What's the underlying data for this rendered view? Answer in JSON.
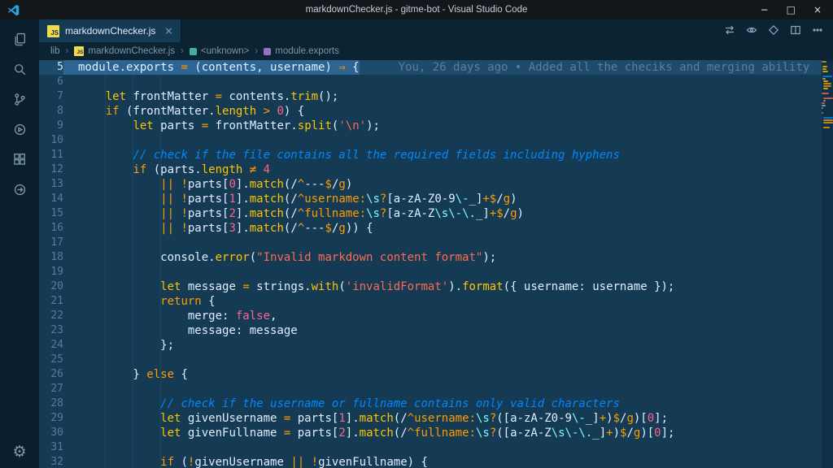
{
  "window": {
    "title": "markdownChecker.js - gitme-bot - Visual Studio Code",
    "controls": {
      "minimize": "−",
      "maximize": "□",
      "close": "×"
    }
  },
  "activity_bar": {
    "items": [
      "explorer",
      "search",
      "source-control",
      "run-debug",
      "extensions",
      "remote"
    ],
    "settings_label": "manage",
    "settings_glyph": "⚙"
  },
  "tab_bar": {
    "js_badge": "JS",
    "tabs": [
      {
        "label": "markdownChecker.js",
        "close": "×",
        "active": true
      }
    ],
    "actions": [
      "open-changes",
      "toggle-blame",
      "compare",
      "split-editor",
      "more-actions"
    ]
  },
  "breadcrumbs": {
    "separator": "›",
    "items": [
      {
        "label": "lib",
        "icon": null
      },
      {
        "label": "markdownChecker.js",
        "icon": "js-file"
      },
      {
        "label": "<unknown>",
        "icon": "symbol-unknown"
      },
      {
        "label": "module.exports",
        "icon": "symbol-module"
      }
    ]
  },
  "editor": {
    "current_line": 5,
    "blame": "You, 26 days ago • Added all the checiks and merging ability",
    "lines": [
      {
        "n": 5,
        "t": [
          [
            "w",
            "module.exports "
          ],
          [
            "o",
            "="
          ],
          [
            "w",
            " (contents, username) "
          ],
          [
            "o",
            "⇒"
          ],
          [
            "w",
            " {"
          ]
        ]
      },
      {
        "n": 6,
        "t": []
      },
      {
        "n": 7,
        "t": [
          [
            "w",
            "    "
          ],
          [
            "y",
            "let"
          ],
          [
            "w",
            " frontMatter "
          ],
          [
            "o",
            "="
          ],
          [
            "w",
            " contents."
          ],
          [
            "y",
            "trim"
          ],
          [
            "w",
            "();"
          ]
        ]
      },
      {
        "n": 8,
        "t": [
          [
            "w",
            "    "
          ],
          [
            "o",
            "if"
          ],
          [
            "w",
            " (frontMatter."
          ],
          [
            "y",
            "length"
          ],
          [
            "w",
            " "
          ],
          [
            "o",
            ">"
          ],
          [
            "w",
            " "
          ],
          [
            "n",
            "0"
          ],
          [
            "w",
            ") {"
          ]
        ]
      },
      {
        "n": 9,
        "t": [
          [
            "w",
            "        "
          ],
          [
            "y",
            "let"
          ],
          [
            "w",
            " parts "
          ],
          [
            "o",
            "="
          ],
          [
            "w",
            " frontMatter."
          ],
          [
            "y",
            "split"
          ],
          [
            "w",
            "("
          ],
          [
            "r",
            "'\\n'"
          ],
          [
            "w",
            ");"
          ]
        ]
      },
      {
        "n": 10,
        "t": []
      },
      {
        "n": 11,
        "t": [
          [
            "w",
            "        "
          ],
          [
            "b",
            "// check if the file contains all the required fields including hyphens"
          ]
        ]
      },
      {
        "n": 12,
        "t": [
          [
            "w",
            "        "
          ],
          [
            "o",
            "if"
          ],
          [
            "w",
            " (parts."
          ],
          [
            "y",
            "length"
          ],
          [
            "w",
            " "
          ],
          [
            "o",
            "≠"
          ],
          [
            "w",
            " "
          ],
          [
            "n",
            "4"
          ]
        ]
      },
      {
        "n": 13,
        "t": [
          [
            "w",
            "            "
          ],
          [
            "o",
            "|| !"
          ],
          [
            "w",
            "parts["
          ],
          [
            "n",
            "0"
          ],
          [
            "w",
            "]."
          ],
          [
            "y",
            "match"
          ],
          [
            "w",
            "(/"
          ],
          [
            "o",
            "^"
          ],
          [
            "w",
            "---"
          ],
          [
            "o",
            "$"
          ],
          [
            "w",
            "/"
          ],
          [
            "o",
            "g"
          ],
          [
            "w",
            ")"
          ]
        ]
      },
      {
        "n": 14,
        "t": [
          [
            "w",
            "            "
          ],
          [
            "o",
            "|| !"
          ],
          [
            "w",
            "parts["
          ],
          [
            "n",
            "1"
          ],
          [
            "w",
            "]."
          ],
          [
            "y",
            "match"
          ],
          [
            "w",
            "(/"
          ],
          [
            "o",
            "^username:"
          ],
          [
            "c",
            "\\s"
          ],
          [
            "o",
            "?"
          ],
          [
            "w",
            "[a-zA-Z0-9"
          ],
          [
            "c",
            "\\-"
          ],
          [
            "w",
            "_]"
          ],
          [
            "o",
            "+$"
          ],
          [
            "w",
            "/"
          ],
          [
            "o",
            "g"
          ],
          [
            "w",
            ")"
          ]
        ]
      },
      {
        "n": 15,
        "t": [
          [
            "w",
            "            "
          ],
          [
            "o",
            "|| !"
          ],
          [
            "w",
            "parts["
          ],
          [
            "n",
            "2"
          ],
          [
            "w",
            "]."
          ],
          [
            "y",
            "match"
          ],
          [
            "w",
            "(/"
          ],
          [
            "o",
            "^fullname:"
          ],
          [
            "c",
            "\\s"
          ],
          [
            "o",
            "?"
          ],
          [
            "w",
            "[a-zA-Z"
          ],
          [
            "c",
            "\\s\\-\\."
          ],
          [
            "w",
            "_]"
          ],
          [
            "o",
            "+$"
          ],
          [
            "w",
            "/"
          ],
          [
            "o",
            "g"
          ],
          [
            "w",
            ")"
          ]
        ]
      },
      {
        "n": 16,
        "t": [
          [
            "w",
            "            "
          ],
          [
            "o",
            "|| !"
          ],
          [
            "w",
            "parts["
          ],
          [
            "n",
            "3"
          ],
          [
            "w",
            "]."
          ],
          [
            "y",
            "match"
          ],
          [
            "w",
            "(/"
          ],
          [
            "o",
            "^"
          ],
          [
            "w",
            "---"
          ],
          [
            "o",
            "$"
          ],
          [
            "w",
            "/"
          ],
          [
            "o",
            "g"
          ],
          [
            "w",
            ")) {"
          ]
        ]
      },
      {
        "n": 17,
        "t": []
      },
      {
        "n": 18,
        "t": [
          [
            "w",
            "            console."
          ],
          [
            "y",
            "error"
          ],
          [
            "w",
            "("
          ],
          [
            "r",
            "\"Invalid markdown content format\""
          ],
          [
            "w",
            ");"
          ]
        ]
      },
      {
        "n": 19,
        "t": []
      },
      {
        "n": 20,
        "t": [
          [
            "w",
            "            "
          ],
          [
            "y",
            "let"
          ],
          [
            "w",
            " message "
          ],
          [
            "o",
            "="
          ],
          [
            "w",
            " strings."
          ],
          [
            "y",
            "with"
          ],
          [
            "w",
            "("
          ],
          [
            "r",
            "'invalidFormat'"
          ],
          [
            "w",
            ")."
          ],
          [
            "y",
            "format"
          ],
          [
            "w",
            "({ username: username });"
          ]
        ]
      },
      {
        "n": 21,
        "t": [
          [
            "w",
            "            "
          ],
          [
            "o",
            "return"
          ],
          [
            "w",
            " {"
          ]
        ]
      },
      {
        "n": 22,
        "t": [
          [
            "w",
            "                merge: "
          ],
          [
            "n",
            "false"
          ],
          [
            "w",
            ","
          ]
        ]
      },
      {
        "n": 23,
        "t": [
          [
            "w",
            "                message: message"
          ]
        ]
      },
      {
        "n": 24,
        "t": [
          [
            "w",
            "            };"
          ]
        ]
      },
      {
        "n": 25,
        "t": []
      },
      {
        "n": 26,
        "t": [
          [
            "w",
            "        } "
          ],
          [
            "o",
            "else"
          ],
          [
            "w",
            " {"
          ]
        ]
      },
      {
        "n": 27,
        "t": []
      },
      {
        "n": 28,
        "t": [
          [
            "w",
            "            "
          ],
          [
            "b",
            "// check if the username or fullname contains only valid characters"
          ]
        ]
      },
      {
        "n": 29,
        "t": [
          [
            "w",
            "            "
          ],
          [
            "y",
            "let"
          ],
          [
            "w",
            " givenUsername "
          ],
          [
            "o",
            "="
          ],
          [
            "w",
            " parts["
          ],
          [
            "n",
            "1"
          ],
          [
            "w",
            "]."
          ],
          [
            "y",
            "match"
          ],
          [
            "w",
            "(/"
          ],
          [
            "o",
            "^username:"
          ],
          [
            "c",
            "\\s"
          ],
          [
            "o",
            "?"
          ],
          [
            "w",
            "(["
          ],
          [
            "w",
            "a-zA-Z0-9"
          ],
          [
            "c",
            "\\-"
          ],
          [
            "w",
            "_]"
          ],
          [
            "o",
            "+"
          ],
          [
            "w",
            ")"
          ],
          [
            "o",
            "$"
          ],
          [
            "w",
            "/"
          ],
          [
            "o",
            "g"
          ],
          [
            "w",
            ")["
          ],
          [
            "n",
            "0"
          ],
          [
            "w",
            "];"
          ]
        ]
      },
      {
        "n": 30,
        "t": [
          [
            "w",
            "            "
          ],
          [
            "y",
            "let"
          ],
          [
            "w",
            " givenFullname "
          ],
          [
            "o",
            "="
          ],
          [
            "w",
            " parts["
          ],
          [
            "n",
            "2"
          ],
          [
            "w",
            "]."
          ],
          [
            "y",
            "match"
          ],
          [
            "w",
            "(/"
          ],
          [
            "o",
            "^fullname:"
          ],
          [
            "c",
            "\\s"
          ],
          [
            "o",
            "?"
          ],
          [
            "w",
            "(["
          ],
          [
            "w",
            "a-zA-Z"
          ],
          [
            "c",
            "\\s\\-\\."
          ],
          [
            "w",
            "_]"
          ],
          [
            "o",
            "+"
          ],
          [
            "w",
            ")"
          ],
          [
            "o",
            "$"
          ],
          [
            "w",
            "/"
          ],
          [
            "o",
            "g"
          ],
          [
            "w",
            ")["
          ],
          [
            "n",
            "0"
          ],
          [
            "w",
            "];"
          ]
        ]
      },
      {
        "n": 31,
        "t": []
      },
      {
        "n": 32,
        "t": [
          [
            "w",
            "            "
          ],
          [
            "o",
            "if"
          ],
          [
            "w",
            " ("
          ],
          [
            "o",
            "!"
          ],
          [
            "w",
            "givenUsername "
          ],
          [
            "o",
            "||"
          ],
          [
            "w",
            " "
          ],
          [
            "o",
            "!"
          ],
          [
            "w",
            "givenFullname) {"
          ]
        ]
      }
    ]
  },
  "colors": {
    "editor-bg": "#143A54",
    "chrome-bg": "#0C2334",
    "activity-bg": "#0A1E2D",
    "titlebar-bg": "#12171C",
    "tab-active-bg": "#143A54",
    "line-band": "#1E4A6B",
    "line-sel": "#2E6491",
    "blame": "#5E7E97",
    "linenum": "#567C99",
    "linenum-active": "#D6E9F8",
    "fg": "#E1EFFF",
    "yellow": "#FFC600",
    "orange": "#FF9D00",
    "comment": "#0088FF",
    "string": "#FF6B50",
    "number": "#FF628C",
    "cyan": "#80FCFF",
    "icon": "#7E99AD",
    "accent-js": "#F0DB4F"
  }
}
